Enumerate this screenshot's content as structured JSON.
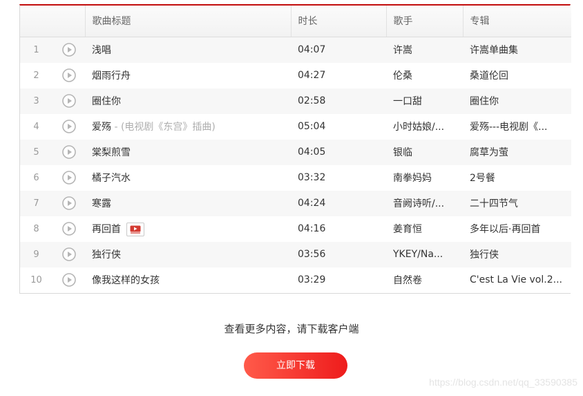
{
  "columns": {
    "title": "歌曲标题",
    "duration": "时长",
    "artist": "歌手",
    "album": "专辑"
  },
  "songs": [
    {
      "index": "1",
      "title": "浅唱",
      "alias": "",
      "mv": false,
      "duration": "04:07",
      "artist": "许嵩",
      "album": "许嵩单曲集"
    },
    {
      "index": "2",
      "title": "烟雨行舟",
      "alias": "",
      "mv": false,
      "duration": "04:27",
      "artist": "伦桑",
      "album": "桑道伦回"
    },
    {
      "index": "3",
      "title": "圈住你",
      "alias": "",
      "mv": false,
      "duration": "02:58",
      "artist": "一口甜",
      "album": "圈住你"
    },
    {
      "index": "4",
      "title": "爱殇",
      "alias": " - (电视剧《东宫》插曲)",
      "mv": false,
      "duration": "05:04",
      "artist": "小时姑娘/...",
      "album": "爱殇---电视剧《..."
    },
    {
      "index": "5",
      "title": "棠梨煎雪",
      "alias": "",
      "mv": false,
      "duration": "04:05",
      "artist": "银临",
      "album": "腐草为萤"
    },
    {
      "index": "6",
      "title": "橘子汽水",
      "alias": "",
      "mv": false,
      "duration": "03:32",
      "artist": "南拳妈妈",
      "album": "2号餐"
    },
    {
      "index": "7",
      "title": "寒露",
      "alias": "",
      "mv": false,
      "duration": "04:24",
      "artist": "音阙诗听/...",
      "album": "二十四节气"
    },
    {
      "index": "8",
      "title": "再回首",
      "alias": "",
      "mv": true,
      "duration": "04:16",
      "artist": "姜育恒",
      "album": "多年以后·再回首"
    },
    {
      "index": "9",
      "title": "独行侠",
      "alias": "",
      "mv": false,
      "duration": "03:56",
      "artist": "YKEY/Na...",
      "album": "独行侠"
    },
    {
      "index": "10",
      "title": "像我这样的女孩",
      "alias": "",
      "mv": false,
      "duration": "03:29",
      "artist": "自然卷",
      "album": "C'est La Vie vol.2..."
    }
  ],
  "footer": {
    "more_text": "查看更多内容，请下载客户端",
    "download_label": "立即下载"
  },
  "watermark": "https://blog.csdn.net/qq_33590385",
  "colors": {
    "accent": "#c20c0c",
    "button": "#ee1c1c"
  }
}
